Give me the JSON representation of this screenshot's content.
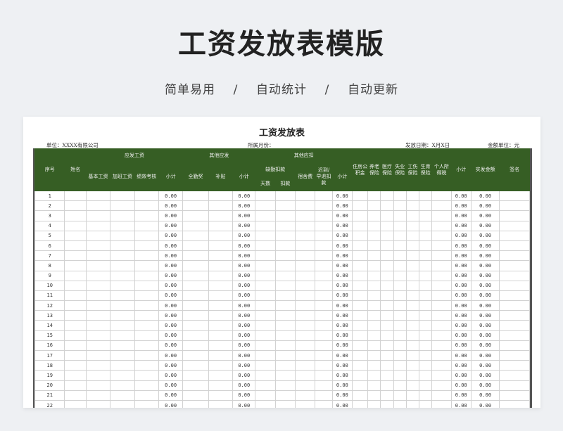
{
  "banner": {
    "title": "工资发放表模版",
    "tagline": "简单易用    /    自动统计    /    自动更新"
  },
  "sheet": {
    "title": "工资发放表",
    "unit_label": "单位：XXXX有限公司",
    "month_label": "所属月份：",
    "pay_date_label": "发放日期：X月X日",
    "currency_label": "金额单位：元"
  },
  "headers": {
    "seq": "序号",
    "name": "姓名",
    "payable_group": "应发工资",
    "base_salary": "基本工资",
    "overtime": "加班工资",
    "performance": "绩效考核",
    "subtotal1": "小计",
    "other_payable_group": "其他应发",
    "attendance_bonus": "全勤奖",
    "allowance": "补贴",
    "subtotal2": "小计",
    "other_deduct_group": "其他应扣",
    "absence_group": "缺勤扣款",
    "days": "天数",
    "deduction": "扣款",
    "dorm_fee": "宿舍费",
    "late_leave": "迟到/早退扣款",
    "subtotal3": "小计",
    "housing_fund": "住房公积金",
    "pension": "养老保险",
    "medical": "医疗保险",
    "unemployment": "失业保险",
    "injury": "工伤保险",
    "maternity": "生育保险",
    "income_tax": "个人所得税",
    "subtotal4": "小计",
    "net_pay": "实发金额",
    "signature": "签名"
  },
  "rows": [
    {
      "seq": "1",
      "v": "0.00"
    },
    {
      "seq": "2",
      "v": "0.00"
    },
    {
      "seq": "3",
      "v": "0.00"
    },
    {
      "seq": "4",
      "v": "0.00"
    },
    {
      "seq": "5",
      "v": "0.00"
    },
    {
      "seq": "6",
      "v": "0.00"
    },
    {
      "seq": "7",
      "v": "0.00"
    },
    {
      "seq": "8",
      "v": "0.00"
    },
    {
      "seq": "9",
      "v": "0.00"
    },
    {
      "seq": "10",
      "v": "0.00"
    },
    {
      "seq": "11",
      "v": "0.00"
    },
    {
      "seq": "12",
      "v": "0.00"
    },
    {
      "seq": "13",
      "v": "0.00"
    },
    {
      "seq": "14",
      "v": "0.00"
    },
    {
      "seq": "15",
      "v": "0.00"
    },
    {
      "seq": "16",
      "v": "0.00"
    },
    {
      "seq": "17",
      "v": "0.00"
    },
    {
      "seq": "18",
      "v": "0.00"
    },
    {
      "seq": "19",
      "v": "0.00"
    },
    {
      "seq": "20",
      "v": "0.00"
    },
    {
      "seq": "21",
      "v": "0.00"
    },
    {
      "seq": "22",
      "v": "0.00"
    }
  ],
  "colors": {
    "header_bg": "#365e24",
    "page_bg": "#eef0f3"
  }
}
